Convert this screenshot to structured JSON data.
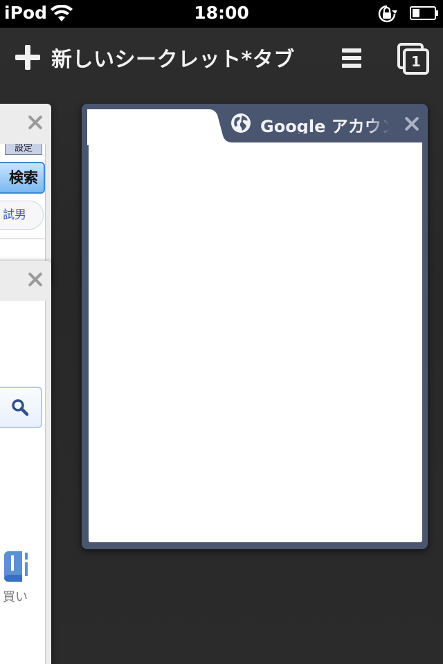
{
  "status_bar": {
    "carrier": "iPod",
    "time": "18:00",
    "icons": [
      "wifi-icon",
      "rotation-lock-icon",
      "battery-icon"
    ]
  },
  "toolbar": {
    "new_tab_label": "新しいシークレット*タブ",
    "tab_count": "1",
    "icons": [
      "plus-icon",
      "menu-icon",
      "tabs-switcher-icon"
    ]
  },
  "background_cards": [
    {
      "settings_label": "設定",
      "search_button_label": "検索",
      "pill_text": "試男"
    },
    {
      "buy_label": "買い",
      "icons": [
        "magnifier-icon",
        "book-icon"
      ]
    }
  ],
  "active_card": {
    "title": "Google アカウント",
    "icon": "globe-icon"
  },
  "colors": {
    "background": "#2a2a2a",
    "card_frame": "#4a5570",
    "search_button": "#7ab8f2"
  }
}
